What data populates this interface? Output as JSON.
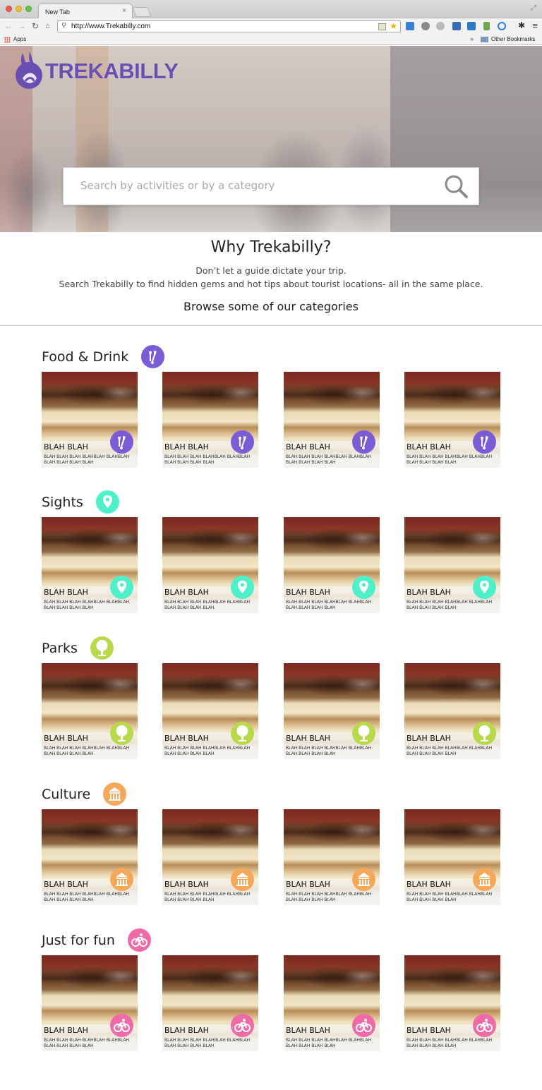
{
  "browser": {
    "tab_title": "New Tab",
    "tab_close": "×",
    "url": "http://www.Trekabilly.com",
    "bookmarks_apps": "Apps",
    "bookmarks_chevron": "»",
    "other_bookmarks": "Other Bookmarks"
  },
  "hero": {
    "logo_text": "TREKABILLY",
    "brand_color": "#6a4fb3",
    "search_placeholder": "Search by activities or by a category"
  },
  "intro": {
    "title": "Why Trekabilly?",
    "line1": "Don’t let a guide dictate your trip.",
    "line2": "Search Trekabilly to find hidden gems and hot tips about tourist locations- all in the same place.",
    "browse": "Browse some of our categories"
  },
  "categories": [
    {
      "name": "Food & Drink",
      "icon": "food-drink-icon",
      "color": "#7a5cd6",
      "cards": [
        {
          "title": "BLAH BLAH",
          "desc": "BLAH BLAH BLAH BLAHBLAH BLAHBLAH BLAH BLAH BLAH BLAH"
        },
        {
          "title": "BLAH BLAH",
          "desc": "BLAH BLAH BLAH BLAHBLAH BLAHBLAH BLAH BLAH BLAH BLAH"
        },
        {
          "title": "BLAH BLAH",
          "desc": "BLAH BLAH BLAH BLAHBLAH BLAHBLAH BLAH BLAH BLAH BLAH"
        },
        {
          "title": "BLAH BLAH",
          "desc": "BLAH BLAH BLAH BLAHBLAH BLAHBLAH BLAH BLAH BLAH BLAH"
        }
      ]
    },
    {
      "name": "Sights",
      "icon": "sights-pin-icon",
      "color": "#4ef0c9",
      "cards": [
        {
          "title": "BLAH BLAH",
          "desc": "BLAH BLAH BLAH BLAHBLAH BLAHBLAH BLAH BLAH BLAH BLAH"
        },
        {
          "title": "BLAH BLAH",
          "desc": "BLAH BLAH BLAH BLAHBLAH BLAHBLAH BLAH BLAH BLAH BLAH"
        },
        {
          "title": "BLAH BLAH",
          "desc": "BLAH BLAH BLAH BLAHBLAH BLAHBLAH BLAH BLAH BLAH BLAH"
        },
        {
          "title": "BLAH BLAH",
          "desc": "BLAH BLAH BLAH BLAHBLAH BLAHBLAH BLAH BLAH BLAH BLAH"
        }
      ]
    },
    {
      "name": "Parks",
      "icon": "tree-icon",
      "color": "#b7d94a",
      "cards": [
        {
          "title": "BLAH BLAH",
          "desc": "BLAH BLAH BLAH BLAHBLAH BLAHBLAH BLAH BLAH BLAH BLAH"
        },
        {
          "title": "BLAH BLAH",
          "desc": "BLAH BLAH BLAH BLAHBLAH BLAHBLAH BLAH BLAH BLAH BLAH"
        },
        {
          "title": "BLAH BLAH",
          "desc": "BLAH BLAH BLAH BLAHBLAH BLAHBLAH BLAH BLAH BLAH BLAH"
        },
        {
          "title": "BLAH BLAH",
          "desc": "BLAH BLAH BLAH BLAHBLAH BLAHBLAH BLAH BLAH BLAH BLAH"
        }
      ]
    },
    {
      "name": "Culture",
      "icon": "museum-icon",
      "color": "#f6a85a",
      "cards": [
        {
          "title": "BLAH BLAH",
          "desc": "BLAH BLAH BLAH BLAHBLAH BLAHBLAH BLAH BLAH BLAH BLAH"
        },
        {
          "title": "BLAH BLAH",
          "desc": "BLAH BLAH BLAH BLAHBLAH BLAHBLAH BLAH BLAH BLAH BLAH"
        },
        {
          "title": "BLAH BLAH",
          "desc": "BLAH BLAH BLAH BLAHBLAH BLAHBLAH BLAH BLAH BLAH BLAH"
        },
        {
          "title": "BLAH BLAH",
          "desc": "BLAH BLAH BLAH BLAHBLAH BLAHBLAH BLAH BLAH BLAH BLAH"
        }
      ]
    },
    {
      "name": "Just for fun",
      "icon": "bicycle-icon",
      "color": "#f06aa8",
      "cards": [
        {
          "title": "BLAH BLAH",
          "desc": "BLAH BLAH BLAH BLAHBLAH BLAHBLAH BLAH BLAH BLAH BLAH"
        },
        {
          "title": "BLAH BLAH",
          "desc": "BLAH BLAH BLAH BLAHBLAH BLAHBLAH BLAH BLAH BLAH BLAH"
        },
        {
          "title": "BLAH BLAH",
          "desc": "BLAH BLAH BLAH BLAHBLAH BLAHBLAH BLAH BLAH BLAH BLAH"
        },
        {
          "title": "BLAH BLAH",
          "desc": "BLAH BLAH BLAH BLAHBLAH BLAHBLAH BLAH BLAH BLAH BLAH"
        }
      ]
    }
  ]
}
